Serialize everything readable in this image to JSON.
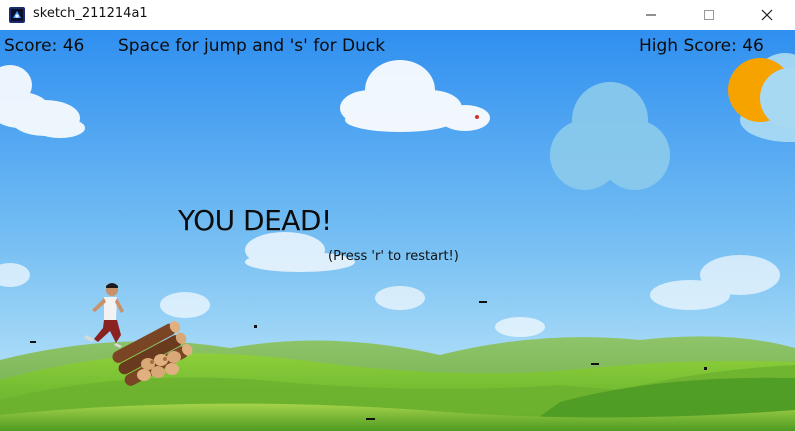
{
  "window": {
    "title": "sketch_211214a1",
    "app_icon": "processing-app-icon",
    "controls": {
      "minimize_icon": "minimize-icon",
      "maximize_icon": "maximize-icon",
      "close_icon": "close-icon"
    }
  },
  "hud": {
    "score": "Score: 46",
    "instructions": "Space for jump and 's' for Duck",
    "high_score": "High Score: 46"
  },
  "game_over": {
    "title": "YOU DEAD!",
    "hint": "(Press 'r' to restart!)"
  },
  "scene": {
    "player": "running-man",
    "obstacle": "log-pile",
    "sun": "sun-icon",
    "colors": {
      "sky_top": "#2f8ff0",
      "sky_bottom": "#bfe6fb",
      "grass": "#7cc33a",
      "sun": "#f6a300"
    }
  }
}
